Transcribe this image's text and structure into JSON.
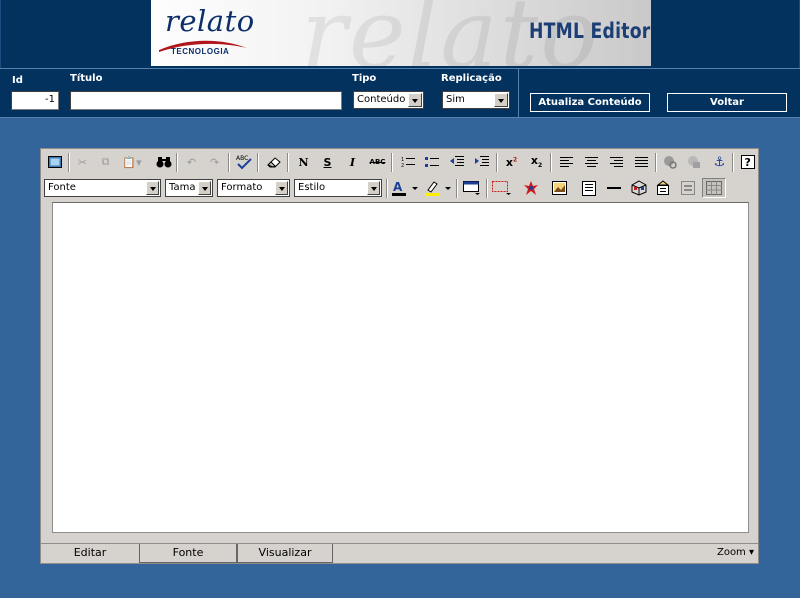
{
  "header": {
    "logo_word": "relato",
    "logo_sub": "TECNOLOGIA",
    "watermark": "relato",
    "product_title": "HTML Editor"
  },
  "form": {
    "id_label": "Id",
    "id_value": "-1",
    "titulo_label": "Título",
    "titulo_value": "",
    "tipo_label": "Tipo",
    "tipo_value": "Conteúdo",
    "replicacao_label": "Replicação",
    "replicacao_value": "Sim",
    "atualiza_button": "Atualiza Conteúdo",
    "voltar_button": "Voltar"
  },
  "toolbar": {
    "font_select": "Fonte",
    "size_select": "Tama",
    "format_select": "Formato",
    "style_select": "Estilo",
    "bold_glyph": "N",
    "underline_glyph": "S",
    "italic_glyph": "I",
    "strike_glyph": "ABC",
    "spell_glyph": "ABC"
  },
  "tabs": {
    "editar": "Editar",
    "fonte": "Fonte",
    "visualizar": "Visualizar",
    "zoom": "Zoom ▾"
  },
  "colors": {
    "page_bg": "#34659a",
    "header_bg": "#04325f",
    "toolbar_bg": "#d6d3ce",
    "brand_red": "#b0171c",
    "brand_navy": "#0c2f6b"
  }
}
